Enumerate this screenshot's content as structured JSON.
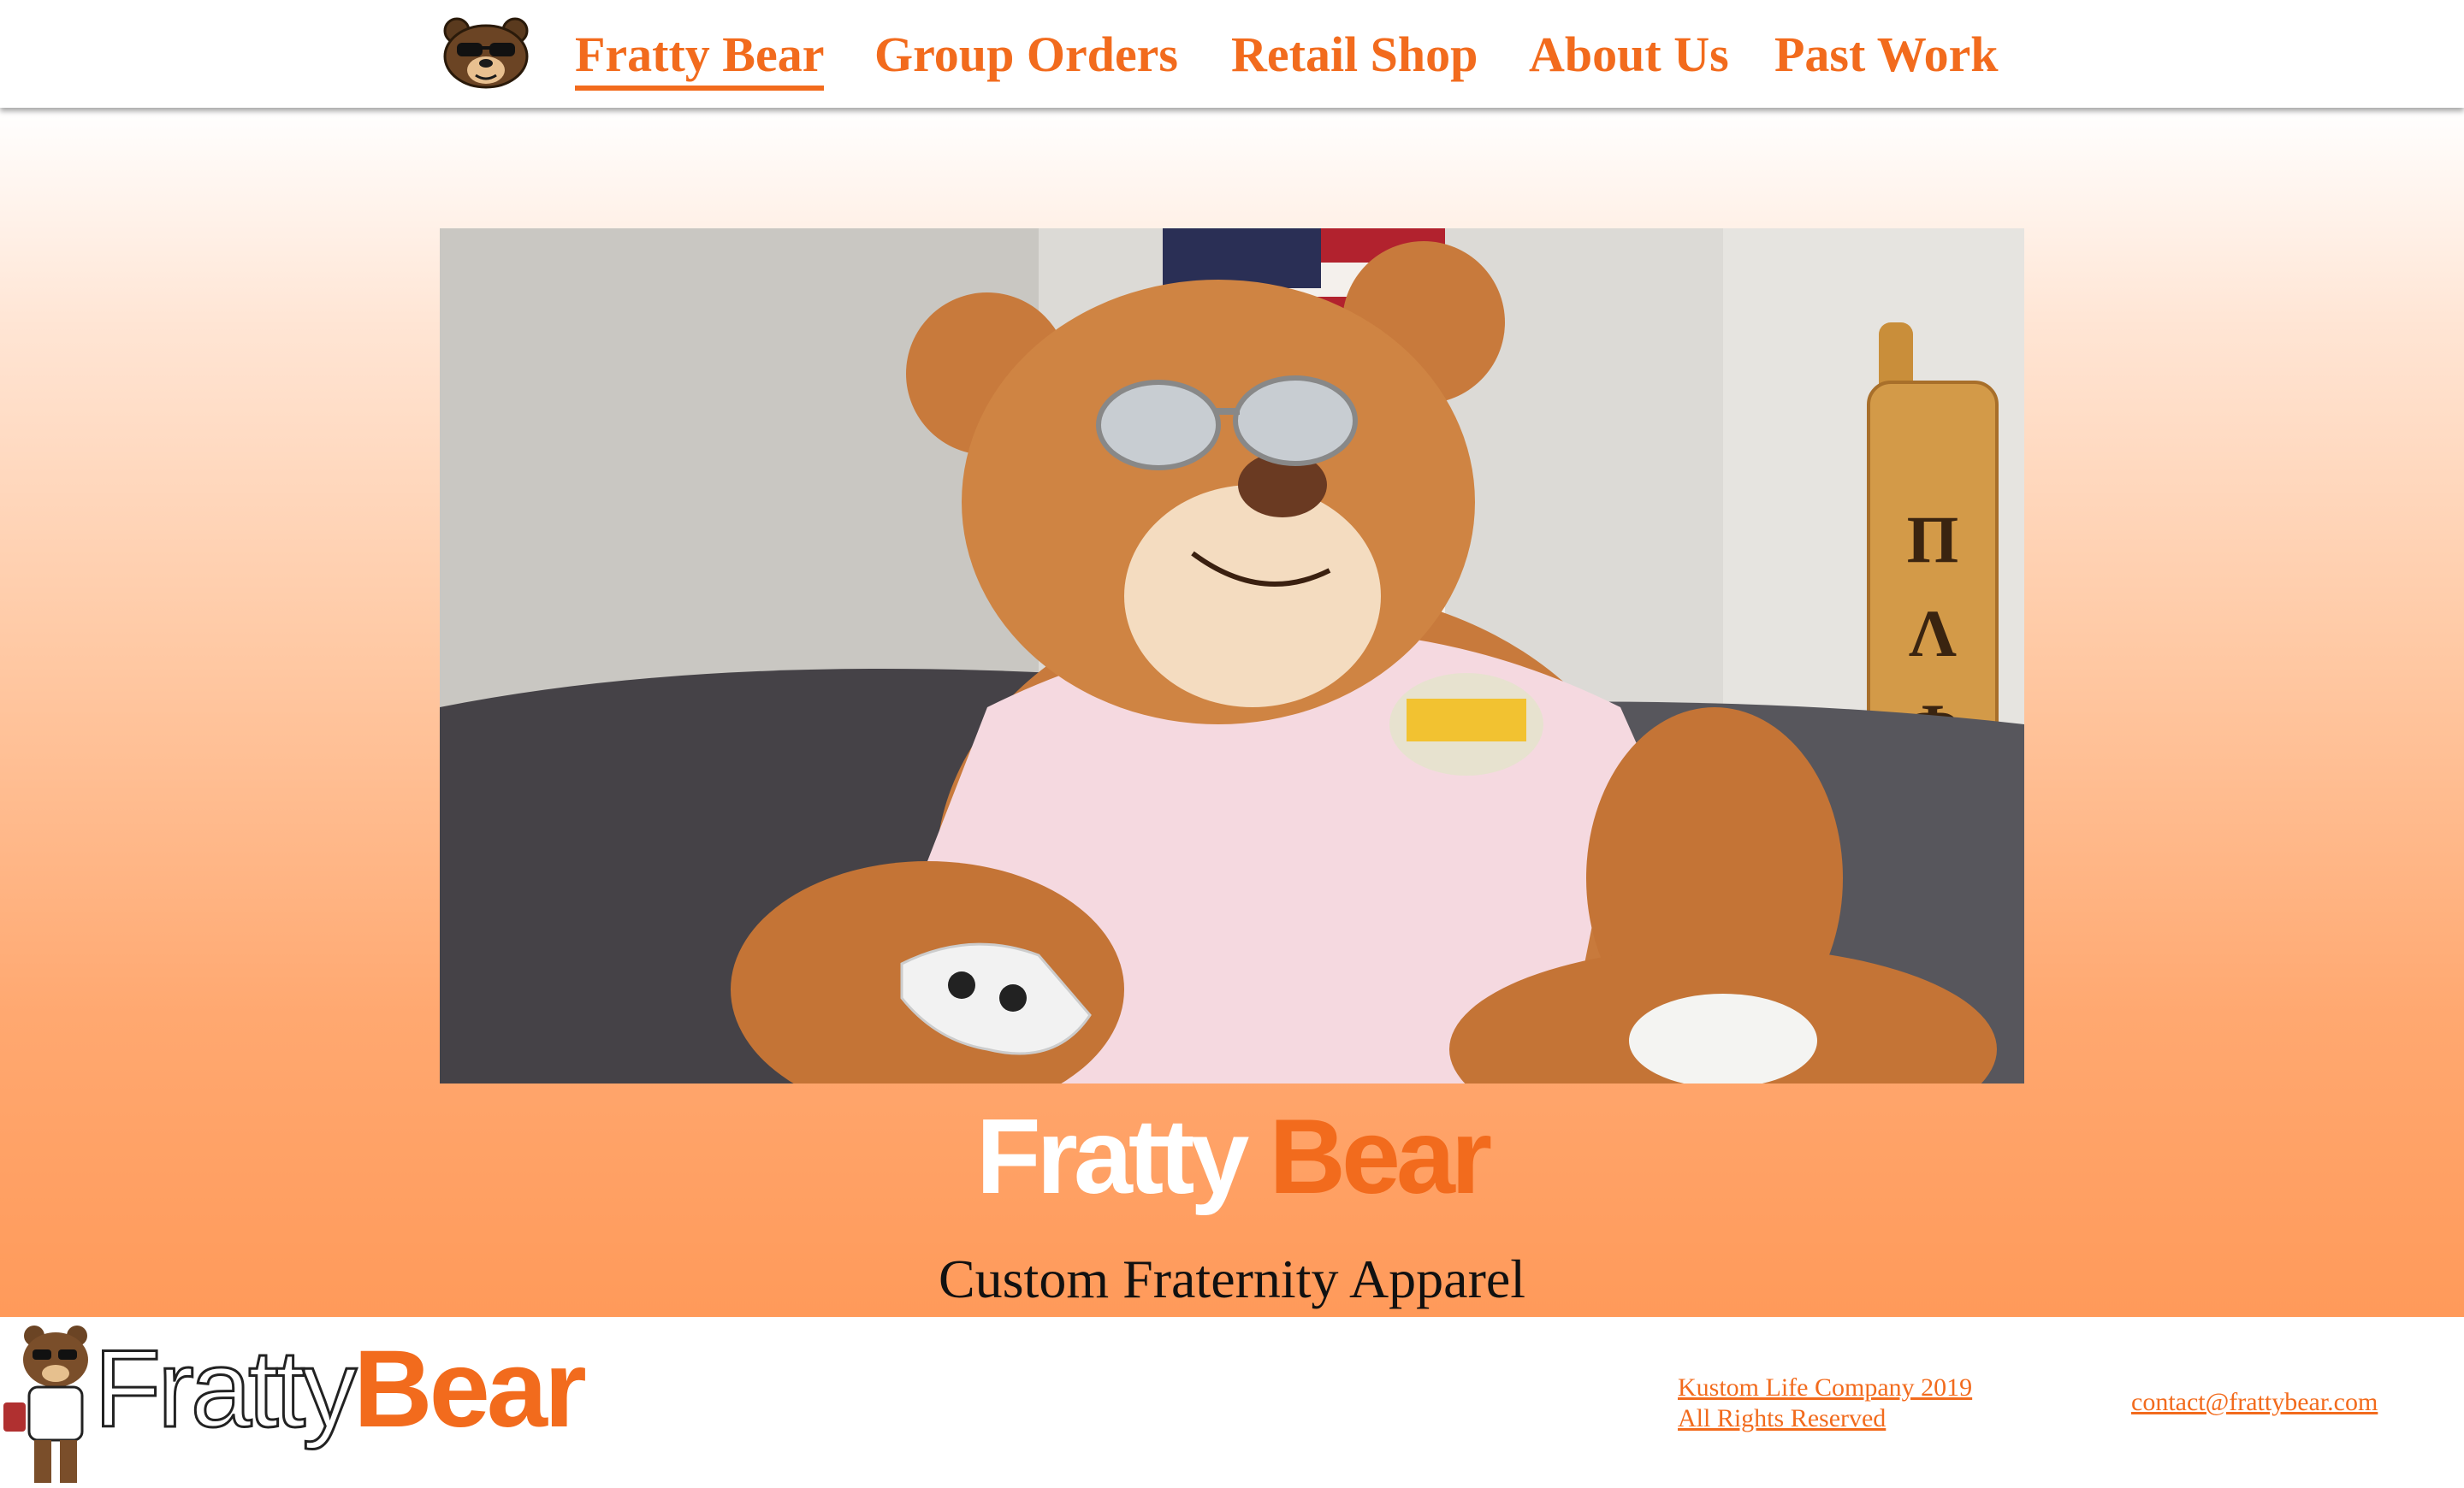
{
  "nav": {
    "logo_icon": "bear-sunglasses-logo-icon",
    "links": [
      {
        "label": "Fratty Bear",
        "active": true
      },
      {
        "label": "Group Orders",
        "active": false
      },
      {
        "label": "Retail Shop",
        "active": false
      },
      {
        "label": "About Us",
        "active": false
      },
      {
        "label": "Past Work",
        "active": false
      }
    ]
  },
  "hero": {
    "photo_subject": "teddy bear in sunglasses and pink shirt holding game controller",
    "brand_word1": "Fratty",
    "brand_word2": "Bear",
    "tagline": "Custom Fraternity Apparel"
  },
  "footer": {
    "logo_word1": "Fratty",
    "logo_word2": "Bear",
    "company": "Kustom Life Company 2019",
    "rights": "All Rights Reserved",
    "contact": "contact@frattybear.com"
  },
  "colors": {
    "brand_orange": "#f26b1d",
    "hero_gradient_bottom": "#ff9a5a"
  }
}
